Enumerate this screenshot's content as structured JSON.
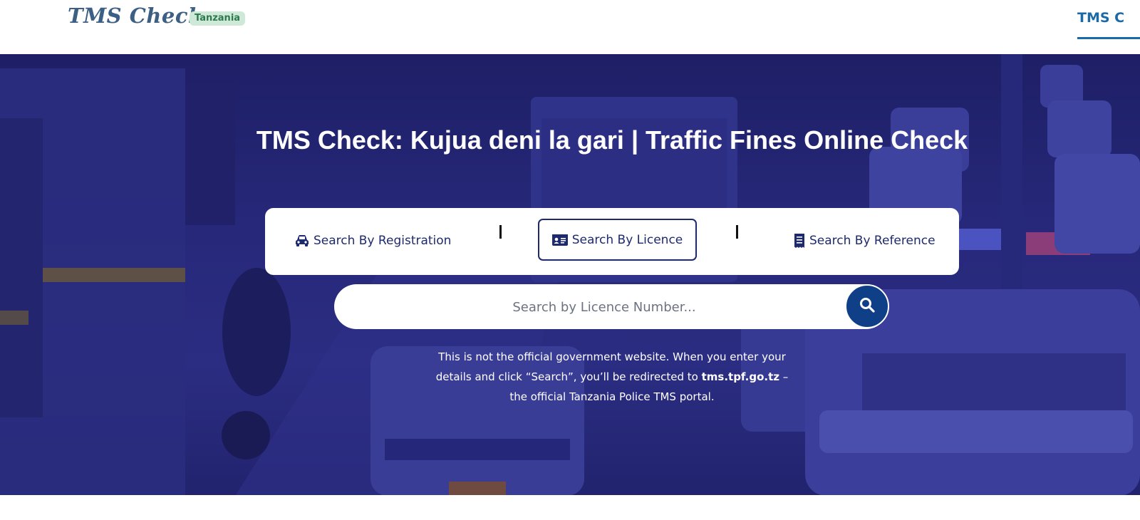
{
  "header": {
    "logo_text": "TMS Check",
    "country_badge": "Tanzania",
    "nav_link": "TMS C"
  },
  "hero": {
    "title": "TMS Check: Kujua deni la gari | Traffic Fines Online Check",
    "tabs": [
      {
        "label": "Search By Registration",
        "icon": "car-icon",
        "active": false
      },
      {
        "label": "Search By Licence",
        "icon": "id-card-icon",
        "active": true
      },
      {
        "label": "Search By Reference",
        "icon": "receipt-icon",
        "active": false
      }
    ],
    "search": {
      "placeholder": "Search by Licence Number...",
      "value": "",
      "button_icon": "search-icon"
    },
    "disclaimer": {
      "part1": "This is not the official government website. When you enter your details and click “Search”, you’ll be redirected to ",
      "link_text": "tms.tpf.go.tz",
      "part2": " – the official Tanzania Police TMS portal."
    }
  },
  "colors": {
    "hero_overlay": "#27287a",
    "brand_blue": "#1b6aa8",
    "tab_text": "#1e2a6e",
    "search_button": "#0f3f86",
    "badge_bg": "#cfe9d9",
    "badge_text": "#2d7a4f"
  }
}
